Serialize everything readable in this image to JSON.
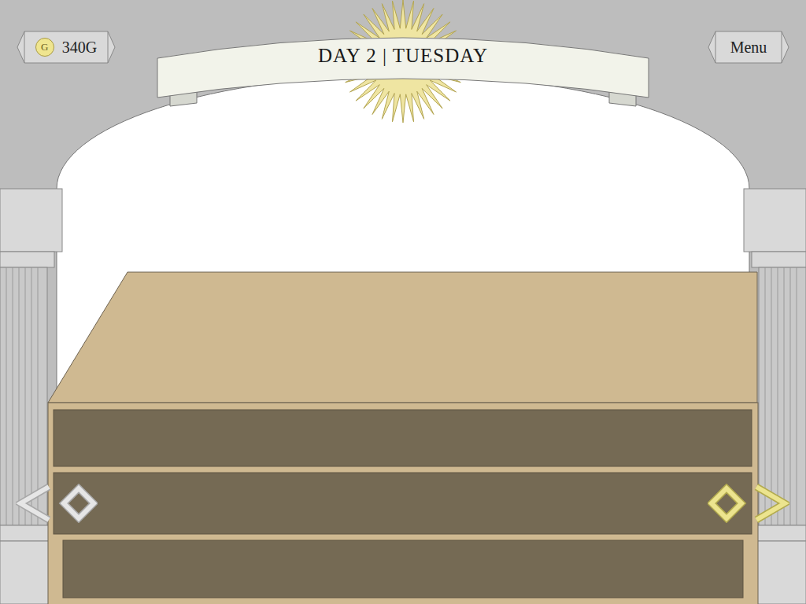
{
  "currency": {
    "icon": "G",
    "amount": "340G"
  },
  "menu": {
    "label": "Menu"
  },
  "banner": {
    "title": "DAY 2 | TUESDAY"
  },
  "navigation": [
    {
      "direction": "left",
      "disabled": true
    },
    {
      "direction": "right",
      "disabled": false
    }
  ]
}
